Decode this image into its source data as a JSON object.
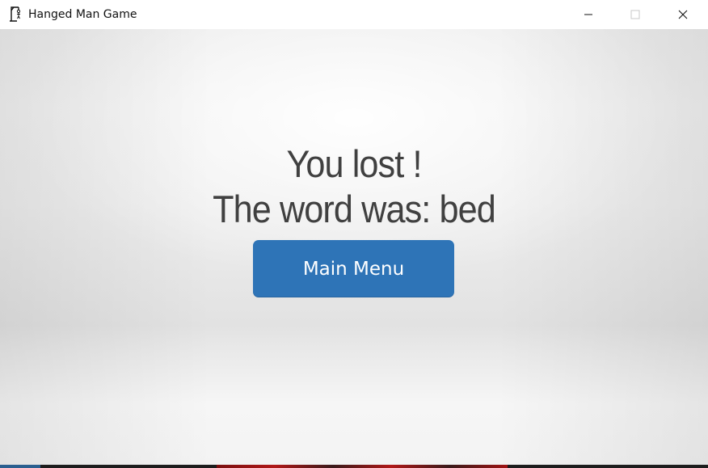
{
  "window": {
    "title": "Hanged Man Game",
    "app_icon": "gallows-icon",
    "controls": {
      "minimize_icon": "minimize-icon",
      "maximize_icon": "maximize-icon",
      "close_icon": "close-icon"
    }
  },
  "game_over": {
    "line1": "You lost !",
    "line2": "The word was: bed",
    "main_menu_label": "Main Menu"
  },
  "colors": {
    "button": "#2e74b7",
    "message_text": "#404040"
  }
}
